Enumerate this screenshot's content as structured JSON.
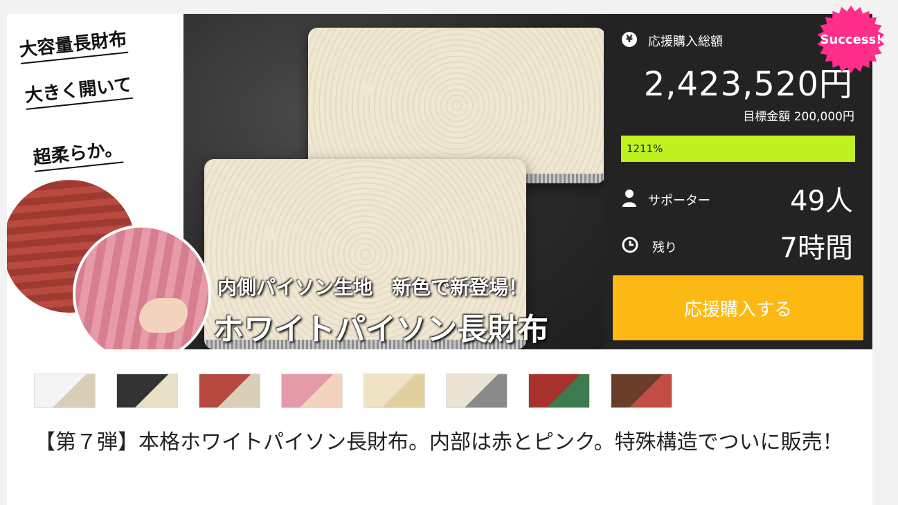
{
  "hero": {
    "taglines": [
      "大容量長財布",
      "大きく開いて",
      "超柔らか。"
    ],
    "caption_line1": "内側パイソン生地　新色で新登場！",
    "caption_line2": "ホワイトパイソン長財布"
  },
  "badge": {
    "label": "Success!",
    "color": "#ff2e8a"
  },
  "stats": {
    "total_label": "応援購入総額",
    "total_icon": "yen-icon",
    "total_amount": "2,423,520円",
    "goal_text": "目標金額 200,000円",
    "progress_percent": 1211,
    "progress_label": "1211%",
    "supporters_label": "サポーター",
    "supporters_icon": "person-icon",
    "supporters_value": "49人",
    "remaining_label": "残り",
    "remaining_icon": "clock-icon",
    "remaining_value": "7時間"
  },
  "cta": {
    "label": "応援購入する",
    "color": "#fdb913"
  },
  "thumbnails": [
    {
      "name": "thumbnail-1",
      "colors": [
        "#f4f4f4",
        "#d9cfb9"
      ]
    },
    {
      "name": "thumbnail-2",
      "colors": [
        "#333333",
        "#e9e0c8"
      ]
    },
    {
      "name": "thumbnail-3",
      "colors": [
        "#b5483f",
        "#d9cfb9"
      ]
    },
    {
      "name": "thumbnail-4",
      "colors": [
        "#e59aa9",
        "#f3d3bd"
      ]
    },
    {
      "name": "thumbnail-5",
      "colors": [
        "#efe3c6",
        "#e2cfa0"
      ]
    },
    {
      "name": "thumbnail-6",
      "colors": [
        "#ebe4d5",
        "#8a8a8a"
      ]
    },
    {
      "name": "thumbnail-7",
      "colors": [
        "#a8322b",
        "#3d7a4e"
      ]
    },
    {
      "name": "thumbnail-8",
      "colors": [
        "#6a3d2b",
        "#c24c46"
      ]
    }
  ],
  "project_title": "【第７弾】本格ホワイトパイソン長財布。内部は赤とピンク。特殊構造でついに販売！"
}
